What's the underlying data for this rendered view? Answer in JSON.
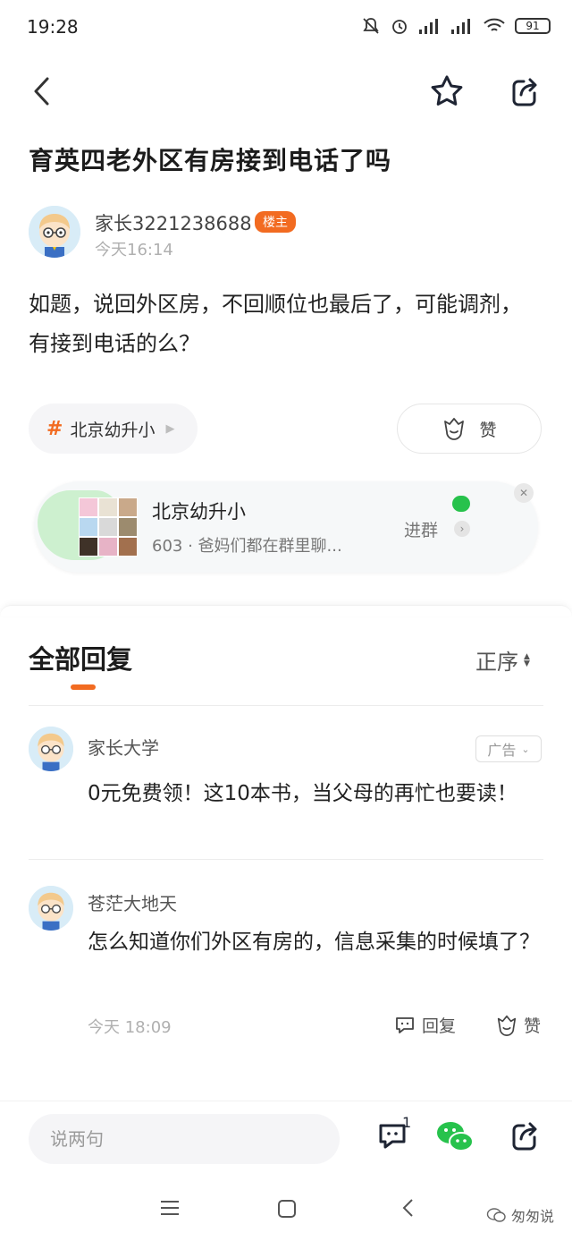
{
  "status_bar": {
    "time": "19:28",
    "battery": "91"
  },
  "post": {
    "title": "育英四老外区有房接到电话了吗",
    "author": "家长3221238688",
    "owner_badge": "楼主",
    "time": "今天16:14",
    "body": "如题，说回外区房，不回顺位也最后了，可能调剂，有接到电话的么？"
  },
  "tag": {
    "label": "北京幼升小"
  },
  "like_label": "赞",
  "group_card": {
    "name": "北京幼升小",
    "subtitle": "603 · 爸妈们都在群里聊...",
    "join_label": "进群"
  },
  "replies": {
    "title": "全部回复",
    "sort_label": "正序",
    "ad": {
      "name": "家长大学",
      "badge": "广告",
      "text": "0元免费领！这10本书，当父母的再忙也要读！"
    },
    "items": [
      {
        "name": "苍茫大地天",
        "text": "怎么知道你们外区有房的，信息采集的时候填了？",
        "time": "今天 18:09",
        "reply_label": "回复",
        "like_label": "赞"
      }
    ]
  },
  "bottom_bar": {
    "input_placeholder": "说两句",
    "comment_count": "1"
  },
  "watermark": "匆匆说",
  "colors": {
    "accent": "#f26b21",
    "wechat": "#27c24c"
  }
}
